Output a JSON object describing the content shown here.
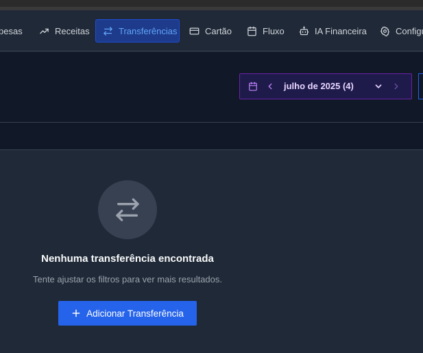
{
  "nav": {
    "items": [
      {
        "label": "pesas",
        "icon": "trending-down-icon"
      },
      {
        "label": "Receitas",
        "icon": "trending-up-icon"
      },
      {
        "label": "Transferências",
        "icon": "transfer-arrows-icon",
        "active": true
      },
      {
        "label": "Cartão",
        "icon": "credit-card-icon"
      },
      {
        "label": "Fluxo",
        "icon": "calendar-icon"
      },
      {
        "label": "IA Financeira",
        "icon": "robot-icon"
      },
      {
        "label": "Configu",
        "icon": "gear-icon"
      }
    ]
  },
  "month_picker": {
    "label": "julho de 2025 (4)"
  },
  "empty_state": {
    "icon": "transfer-arrows-icon",
    "title": "Nenhuma transferência encontrada",
    "subtitle": "Tente ajustar os filtros para ver mais resultados.",
    "button_label": "Adicionar Transferência"
  },
  "colors": {
    "accent": "#2563eb",
    "active_nav_bg": "#1e3a8a",
    "picker_border": "#6b21a8",
    "background": "#1f2937"
  }
}
